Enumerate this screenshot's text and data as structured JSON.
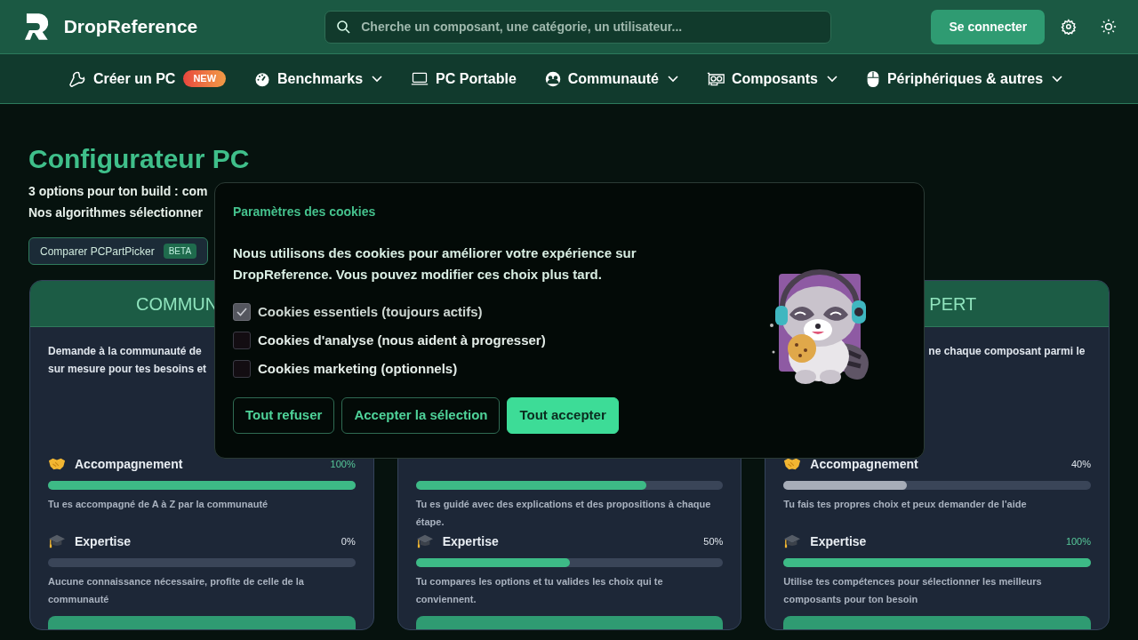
{
  "header": {
    "brand": "DropReference",
    "search": {
      "placeholder": "Cherche un composant, une catégorie, un utilisateur..."
    },
    "login_button": "Se connecter"
  },
  "nav": [
    {
      "label": "Créer un PC",
      "badge": "NEW",
      "dropdown": false
    },
    {
      "label": "Benchmarks",
      "dropdown": true
    },
    {
      "label": "PC Portable",
      "dropdown": false
    },
    {
      "label": "Communauté",
      "dropdown": true
    },
    {
      "label": "Composants",
      "dropdown": true
    },
    {
      "label": "Périphériques & autres",
      "dropdown": true
    }
  ],
  "page": {
    "title": "Configurateur PC",
    "intro_lines": [
      "3 options pour ton build : com",
      "Nos algorithmes sélectionner"
    ],
    "compare_button": {
      "label": "Comparer PCPartPicker",
      "badge": "BETA"
    }
  },
  "cards": [
    {
      "title": "COMMUN",
      "description_lines": [
        "Demande à la communauté de",
        "sur mesure pour tes besoins et"
      ],
      "metrics": [
        {
          "kind": "accompagnement",
          "label": "Accompagnement",
          "value": "100%",
          "level": 1,
          "color": "#3dba86",
          "description": "Tu es accompagné de A à Z par la communauté"
        },
        {
          "kind": "expertise",
          "label": "Expertise",
          "value": "0%",
          "level": 0,
          "description": "Aucune connaissance nécessaire, profite de celle de la communauté"
        }
      ]
    },
    {
      "metrics": [
        {
          "kind": "bar_only",
          "level": 0.75,
          "color": "#3dba86",
          "description": "Tu es guidé avec des explications et des propositions à chaque étape."
        },
        {
          "kind": "expertise",
          "label": "Expertise",
          "value": "50%",
          "level": 0.5,
          "color": "#3dba86",
          "description": "Tu compares les options et tu valides les choix qui te conviennent."
        }
      ]
    },
    {
      "title": "PERT",
      "description_lines": [
        "ne chaque composant parmi le"
      ],
      "metrics": [
        {
          "kind": "accompagnement",
          "label": "Accompagnement",
          "value": "40%",
          "level": 0.4,
          "color": "#a7adb8",
          "description": "Tu fais tes propres choix et peux demander de l'aide"
        },
        {
          "kind": "expertise",
          "label": "Expertise",
          "value": "100%",
          "level": 1,
          "color": "#3dba86",
          "description": "Utilise tes compétences pour sélectionner les meilleurs composants pour ton besoin"
        }
      ]
    }
  ],
  "cookie_dialog": {
    "title": "Paramètres des cookies",
    "message": "Nous utilisons des cookies pour améliorer votre expérience sur DropReference. Vous pouvez modifier ces choix plus tard.",
    "options": [
      {
        "label": "Cookies essentiels (toujours actifs)",
        "checked": true,
        "disabled": true
      },
      {
        "label": "Cookies d'analyse (nous aident à progresser)",
        "checked": false,
        "disabled": false
      },
      {
        "label": "Cookies marketing (optionnels)",
        "checked": false,
        "disabled": false
      }
    ],
    "buttons": [
      {
        "label": "Tout refuser",
        "kind": "outline"
      },
      {
        "label": "Accepter la sélection",
        "kind": "outline"
      },
      {
        "label": "Tout accepter",
        "kind": "primary"
      }
    ]
  }
}
